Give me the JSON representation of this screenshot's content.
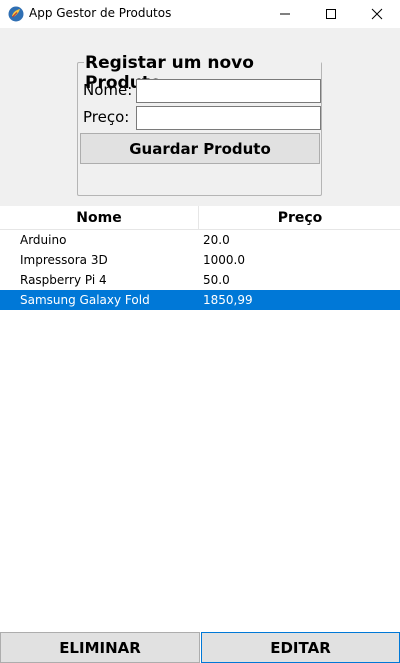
{
  "window": {
    "title": "App Gestor de Produtos"
  },
  "form": {
    "legend": "Registar um novo Produto",
    "nome_label": "Nome:",
    "preco_label": "Preço:",
    "nome_value": "",
    "preco_value": "",
    "save_label": "Guardar Produto"
  },
  "table": {
    "headers": [
      "Nome",
      "Preço"
    ],
    "rows": [
      {
        "nome": "Arduino",
        "preco": "20.0",
        "selected": false
      },
      {
        "nome": "Impressora 3D",
        "preco": "1000.0",
        "selected": false
      },
      {
        "nome": "Raspberry Pi 4",
        "preco": "50.0",
        "selected": false
      },
      {
        "nome": "Samsung Galaxy Fold",
        "preco": "1850,99",
        "selected": true
      }
    ]
  },
  "actions": {
    "delete_label": "ELIMINAR",
    "edit_label": "EDITAR"
  },
  "colors": {
    "selection": "#0078d7",
    "button_face": "#e1e1e1",
    "form_bg": "#f0f0f0"
  }
}
